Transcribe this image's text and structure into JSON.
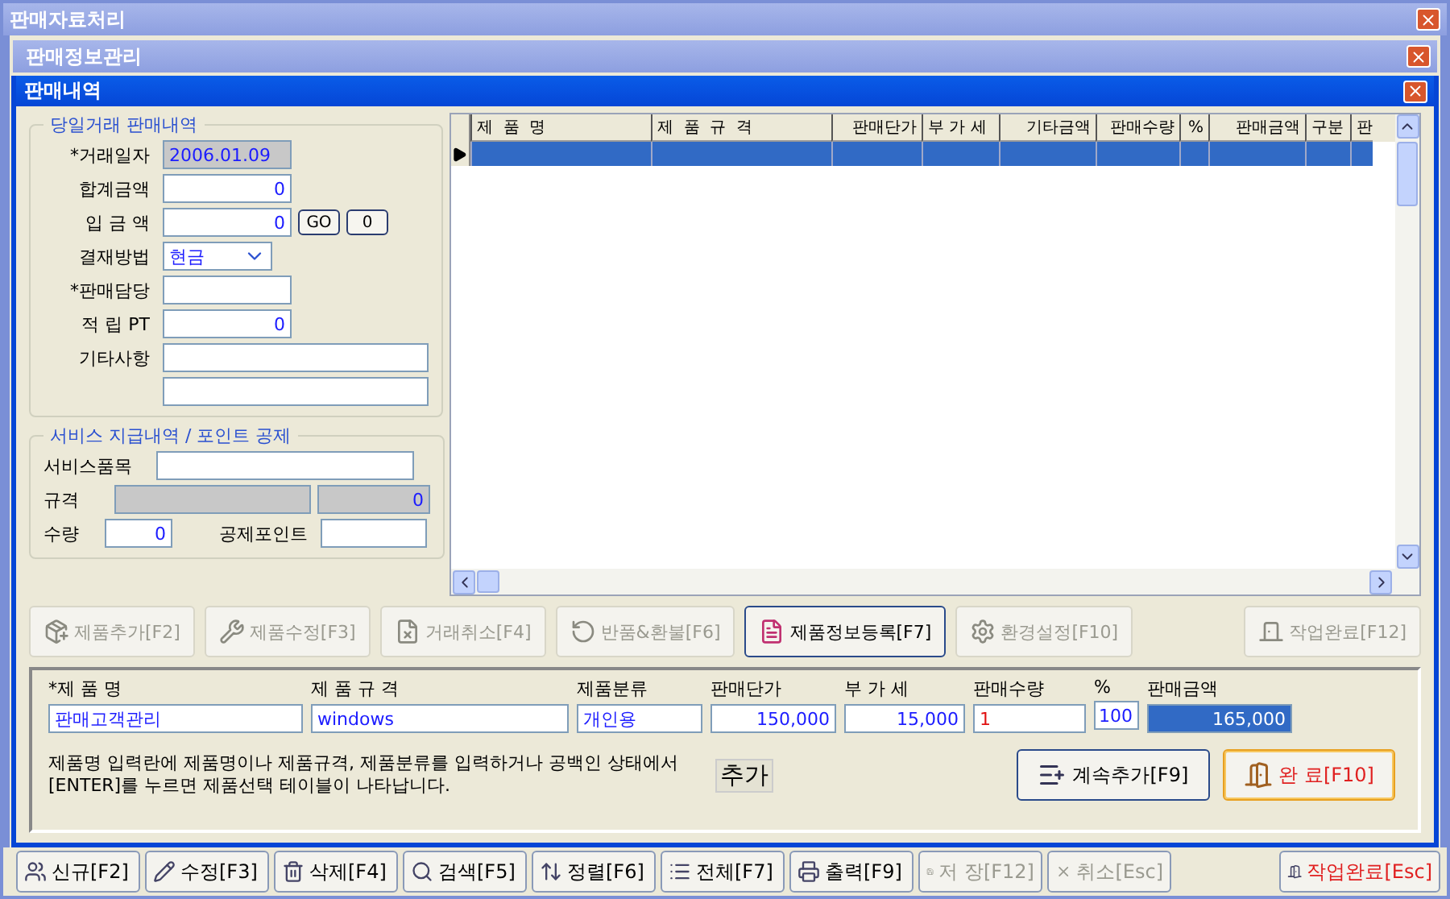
{
  "main_window": {
    "title": "판매자료처리"
  },
  "sub_window": {
    "title": "판매정보관리"
  },
  "dialog": {
    "title": "판매내역"
  },
  "sale_section": {
    "legend": "당일거래 판매내역",
    "fields": [
      {
        "label": "*거래일자",
        "value": "2006.01.09",
        "kind": "readonly"
      },
      {
        "label": "합계금액",
        "value": "0",
        "kind": "number"
      },
      {
        "label": "입 금 액",
        "value": "0",
        "kind": "number",
        "buttons": [
          "GO",
          "0"
        ]
      },
      {
        "label": "결재방법",
        "value": "현금",
        "kind": "select"
      },
      {
        "label": "*판매담당",
        "kind": "short"
      },
      {
        "label": "적 립 PT",
        "value": "0",
        "kind": "number"
      },
      {
        "label": "기타사항",
        "kind": "memo"
      }
    ]
  },
  "service_section": {
    "legend": "서비스 지급내역 / 포인트 공제",
    "item_label": "서비스품목",
    "spec_label": "규격",
    "spec_value": "0",
    "qty_label": "수량",
    "qty_value": "0",
    "points_label": "공제포인트"
  },
  "grid": {
    "columns": [
      "제  품  명",
      "제  품  규  격",
      "판매단가",
      "부 가 세",
      "기타금액",
      "판매수량",
      "%",
      "판매금액",
      "구분",
      "판"
    ],
    "rows": [
      {
        "selected": true
      }
    ]
  },
  "actions": [
    {
      "label": "제품추가[F2]",
      "disabled": true,
      "kind": "action"
    },
    {
      "label": "제품수정[F3]",
      "disabled": true,
      "kind": "action"
    },
    {
      "label": "거래취소[F4]",
      "disabled": true,
      "kind": "action"
    },
    {
      "label": "반품&환불[F6]",
      "disabled": true,
      "kind": "action"
    },
    {
      "label": "제품정보등록[F7]",
      "disabled": false,
      "kind": "action"
    },
    {
      "label": "환경설정[F10]",
      "disabled": true,
      "kind": "action"
    },
    {
      "label": "작업완료[F12]",
      "disabled": true,
      "kind": "exit"
    }
  ],
  "entry": {
    "fields": [
      {
        "label": "*제  품  명",
        "value": "판매고객관리",
        "kind": "text"
      },
      {
        "label": "제 품 규 격",
        "value": "windows",
        "kind": "text"
      },
      {
        "label": "제품분류",
        "value": "개인용",
        "kind": "text"
      },
      {
        "label": "판매단가",
        "value": "150,000",
        "kind": "number"
      },
      {
        "label": "부 가 세",
        "value": "15,000",
        "kind": "number"
      },
      {
        "label": "판매수량",
        "value": "1",
        "kind": "quantity"
      },
      {
        "label": "%",
        "value": "100",
        "kind": "number"
      },
      {
        "label": "판매금액",
        "value": "165,000",
        "kind": "total"
      }
    ],
    "note": "제품명 입력란에 제품명이나 제품규격, 제품분류를 입력하거나 공백인 상태에서 [ENTER]를 누르면 제품선택 테이블이 나타납니다.",
    "mode": "추가",
    "buttons": [
      {
        "label": "계속추가[F9]",
        "focused": false
      },
      {
        "label": "완 료[F10]",
        "focused": true
      }
    ]
  },
  "toolbar": [
    {
      "label": "신규[F2]",
      "disabled": false,
      "kind": "action"
    },
    {
      "label": "수정[F3]",
      "disabled": false,
      "kind": "action"
    },
    {
      "label": "삭제[F4]",
      "disabled": false,
      "kind": "action"
    },
    {
      "label": "검색[F5]",
      "disabled": false,
      "kind": "action"
    },
    {
      "label": "정렬[F6]",
      "disabled": false,
      "kind": "action"
    },
    {
      "label": "전체[F7]",
      "disabled": false,
      "kind": "action"
    },
    {
      "label": "출력[F9]",
      "disabled": false,
      "kind": "action"
    },
    {
      "label": "저 장[F12]",
      "disabled": true,
      "kind": "action"
    },
    {
      "label": "취소[Esc]",
      "disabled": true,
      "kind": "action"
    },
    {
      "label": "작업완료[Esc]",
      "disabled": false,
      "kind": "exit"
    }
  ]
}
